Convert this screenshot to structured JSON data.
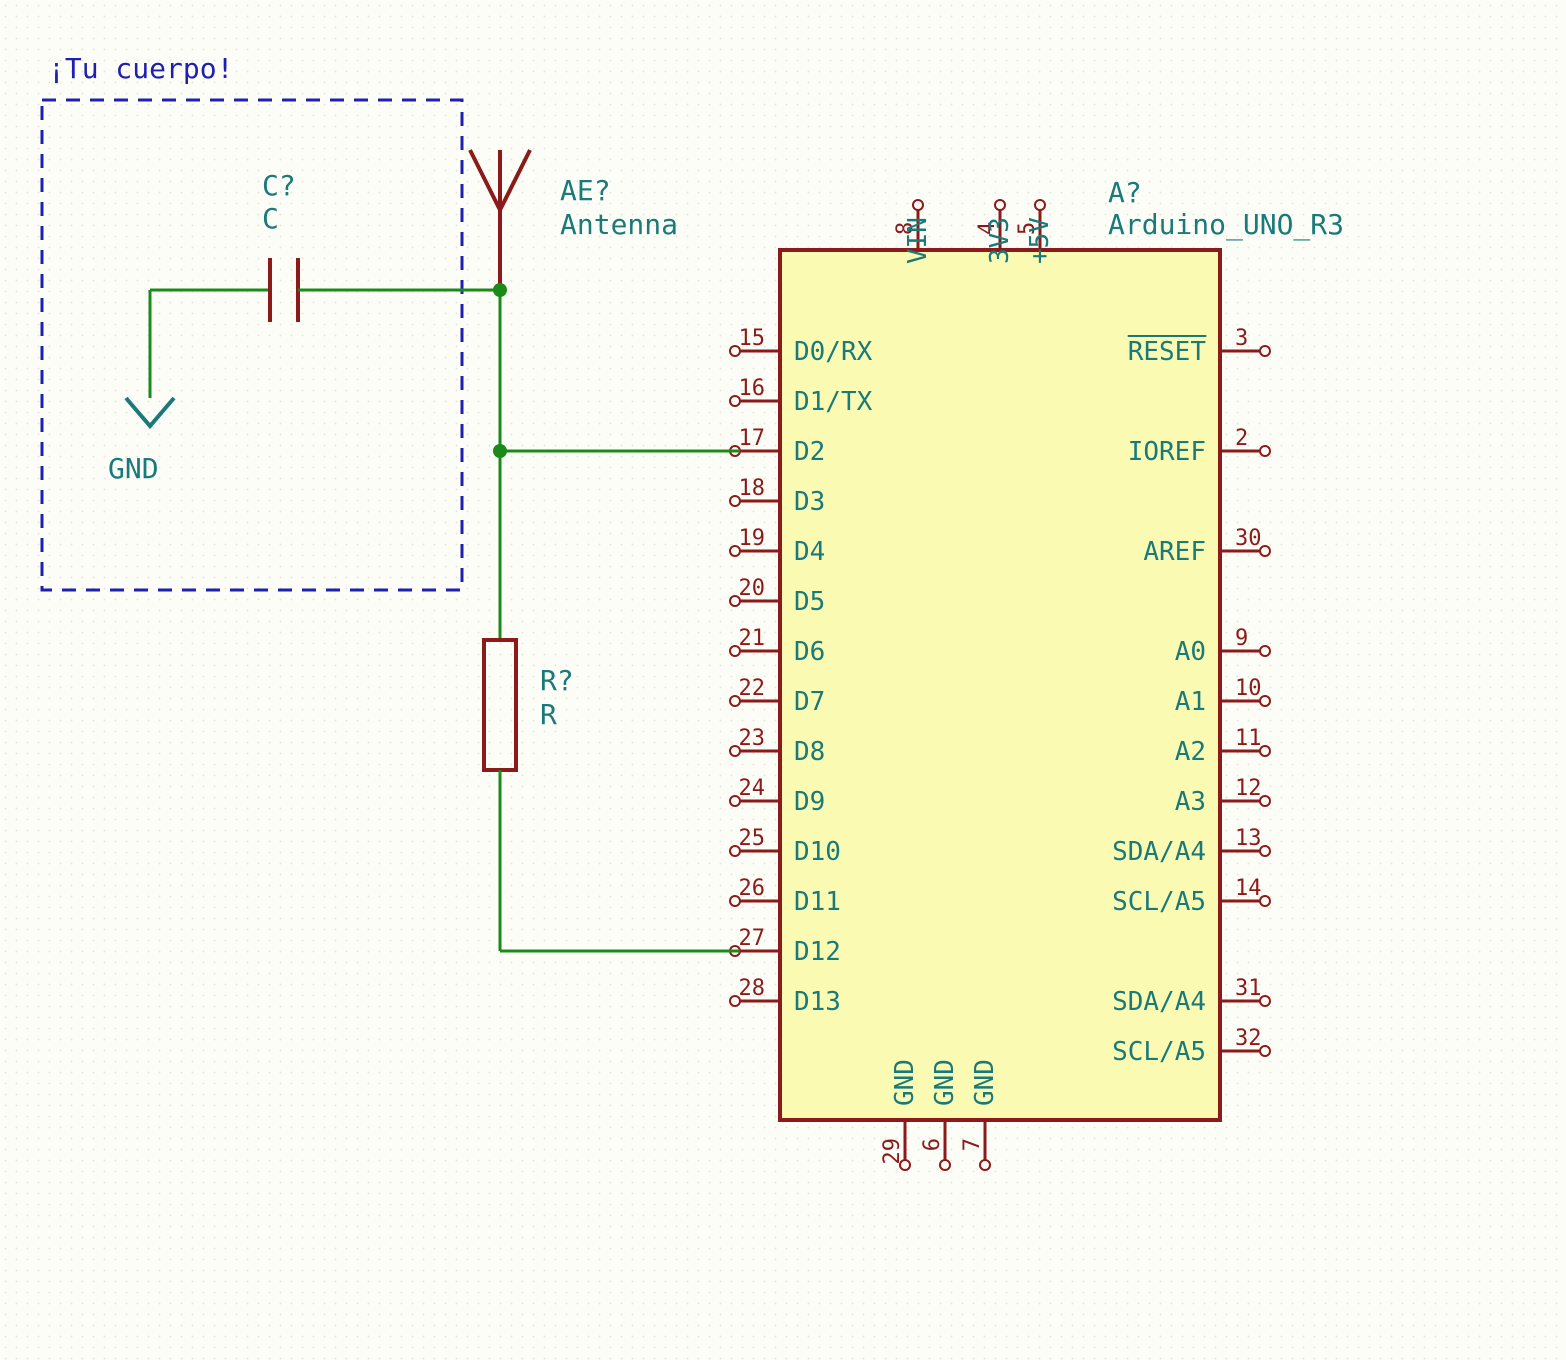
{
  "box": {
    "title": "¡Tu cuerpo!"
  },
  "cap": {
    "ref": "C?",
    "val": "C"
  },
  "ant": {
    "ref": "AE?",
    "val": "Antenna"
  },
  "res": {
    "ref": "R?",
    "val": "R"
  },
  "gnd": {
    "label": "GND"
  },
  "chip": {
    "ref": "A?",
    "val": "Arduino_UNO_R3",
    "top": [
      {
        "num": "8",
        "name": "VIN"
      },
      {
        "num": "4",
        "name": "3V3"
      },
      {
        "num": "5",
        "name": "+5V"
      }
    ],
    "left": [
      {
        "num": "15",
        "name": "D0/RX"
      },
      {
        "num": "16",
        "name": "D1/TX"
      },
      {
        "num": "17",
        "name": "D2"
      },
      {
        "num": "18",
        "name": "D3"
      },
      {
        "num": "19",
        "name": "D4"
      },
      {
        "num": "20",
        "name": "D5"
      },
      {
        "num": "21",
        "name": "D6"
      },
      {
        "num": "22",
        "name": "D7"
      },
      {
        "num": "23",
        "name": "D8"
      },
      {
        "num": "24",
        "name": "D9"
      },
      {
        "num": "25",
        "name": "D10"
      },
      {
        "num": "26",
        "name": "D11"
      },
      {
        "num": "27",
        "name": "D12"
      },
      {
        "num": "28",
        "name": "D13"
      }
    ],
    "right": [
      {
        "num": "3",
        "name": "RESET",
        "bar": true
      },
      {
        "num": "",
        "name": ""
      },
      {
        "num": "2",
        "name": "IOREF"
      },
      {
        "num": "",
        "name": ""
      },
      {
        "num": "30",
        "name": "AREF"
      },
      {
        "num": "",
        "name": ""
      },
      {
        "num": "9",
        "name": "A0"
      },
      {
        "num": "10",
        "name": "A1"
      },
      {
        "num": "11",
        "name": "A2"
      },
      {
        "num": "12",
        "name": "A3"
      },
      {
        "num": "13",
        "name": "SDA/A4"
      },
      {
        "num": "14",
        "name": "SCL/A5"
      },
      {
        "num": "",
        "name": ""
      },
      {
        "num": "31",
        "name": "SDA/A4"
      },
      {
        "num": "32",
        "name": "SCL/A5"
      }
    ],
    "bottom": [
      {
        "num": "29",
        "name": "GND"
      },
      {
        "num": "6",
        "name": "GND"
      },
      {
        "num": "7",
        "name": "GND"
      }
    ]
  }
}
